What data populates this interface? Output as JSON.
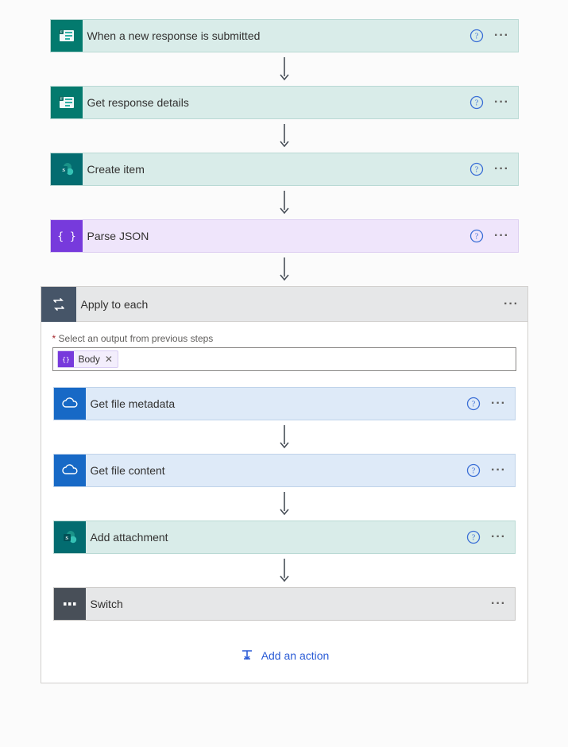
{
  "steps": {
    "trigger": {
      "title": "When a new response is submitted"
    },
    "get_response": {
      "title": "Get response details"
    },
    "create_item": {
      "title": "Create item"
    },
    "parse_json": {
      "title": "Parse JSON"
    }
  },
  "apply": {
    "title": "Apply to each",
    "field_label": "Select an output from previous steps",
    "token": {
      "label": "Body"
    },
    "nested": {
      "get_metadata": {
        "title": "Get file metadata"
      },
      "get_content": {
        "title": "Get file content"
      },
      "add_attachment": {
        "title": "Add attachment"
      },
      "switch": {
        "title": "Switch"
      }
    },
    "add_action_label": "Add an action"
  }
}
